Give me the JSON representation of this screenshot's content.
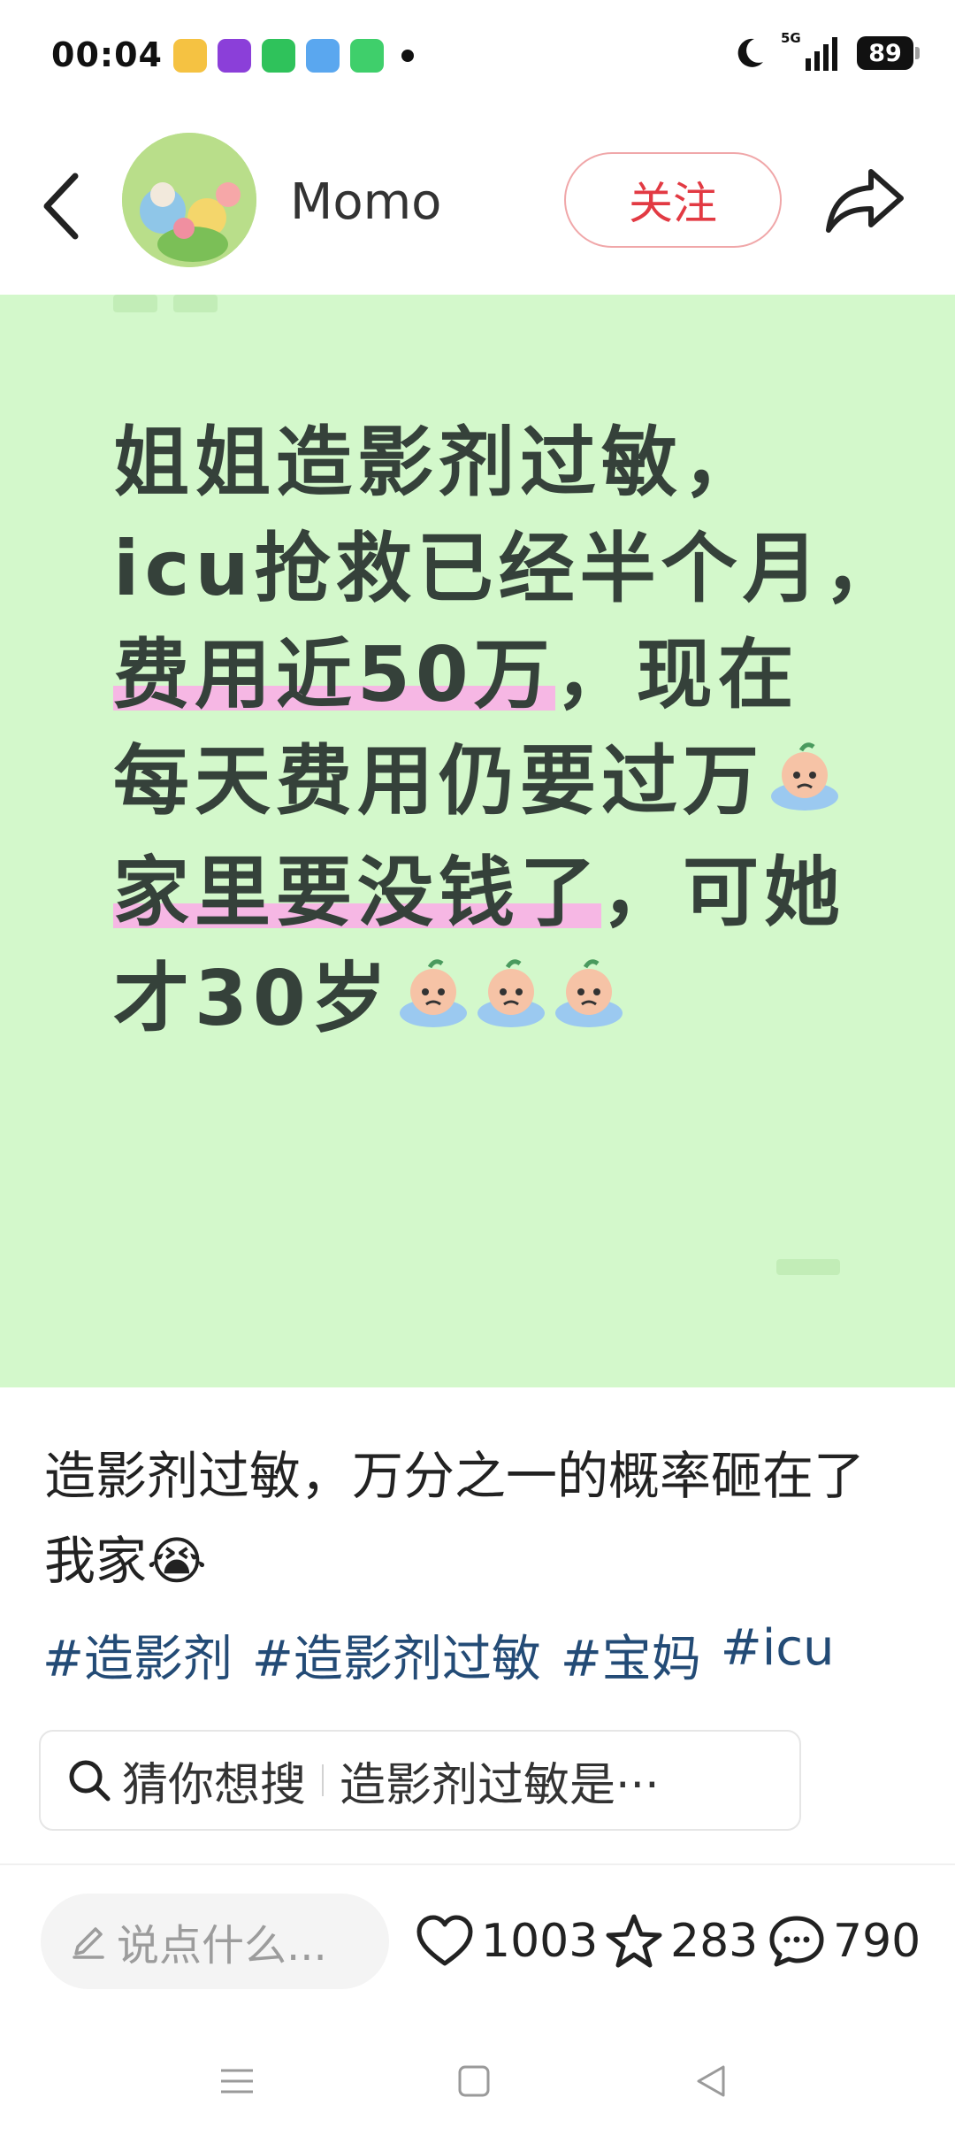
{
  "status_bar": {
    "time": "00:04",
    "network": "5G",
    "battery": "89",
    "app_icons": [
      "weibo-icon",
      "video-app-icon",
      "wechat-icon",
      "weather-icon",
      "message-icon"
    ]
  },
  "header": {
    "username": "Momo",
    "follow_label": "关注"
  },
  "post_image": {
    "lines": [
      "姐姐造影剂过敏，",
      "icu抢救已经半个月，",
      "费用近50万，现在",
      "每天费用仍要过万",
      "家里要没钱了，可她",
      "才30岁"
    ],
    "line3_highlight": "费用近50万",
    "line3_rest": "，现在",
    "line5_highlight": "家里要没钱了",
    "line5_rest": "，可她",
    "background_color": "#d3f8cb",
    "highlight_color": "#f6b7e4"
  },
  "caption": {
    "text": "造影剂过敏，万分之一的概率砸在了我家😭"
  },
  "hashtags": [
    "#造影剂",
    "#造影剂过敏",
    "#宝妈",
    "#icu"
  ],
  "search_suggestion": {
    "prefix": "猜你想搜",
    "query": "造影剂过敏是···"
  },
  "bottom_bar": {
    "comment_placeholder": "说点什么...",
    "likes": "1003",
    "collects": "283",
    "comments": "790"
  }
}
